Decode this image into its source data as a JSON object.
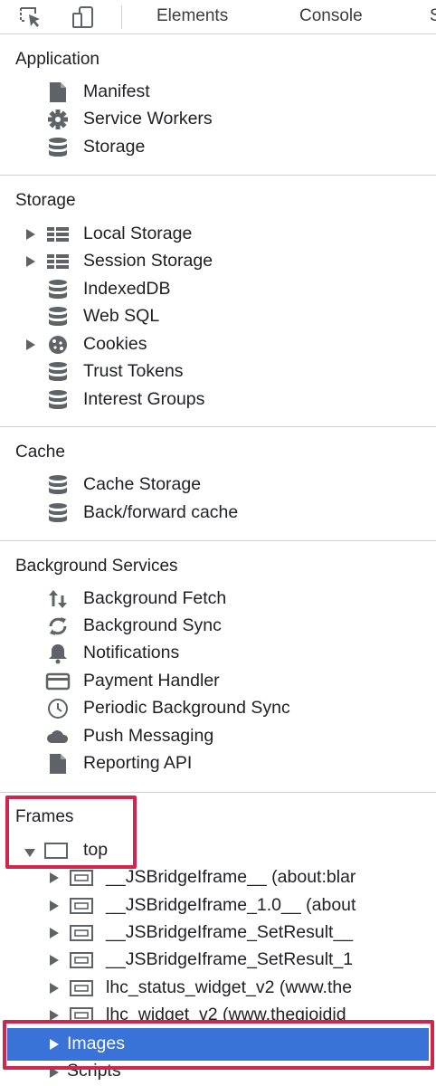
{
  "toolbar": {
    "icons": [
      "inspect-element-icon",
      "device-toggle-icon"
    ],
    "tabs": [
      "Elements",
      "Console",
      "S"
    ]
  },
  "application": {
    "title": "Application",
    "items": [
      {
        "label": "Manifest",
        "icon": "document-icon"
      },
      {
        "label": "Service Workers",
        "icon": "gear-icon"
      },
      {
        "label": "Storage",
        "icon": "database-icon"
      }
    ]
  },
  "storage": {
    "title": "Storage",
    "items": [
      {
        "label": "Local Storage",
        "icon": "table-grid-icon",
        "expandable": true
      },
      {
        "label": "Session Storage",
        "icon": "table-grid-icon",
        "expandable": true
      },
      {
        "label": "IndexedDB",
        "icon": "database-icon"
      },
      {
        "label": "Web SQL",
        "icon": "database-icon"
      },
      {
        "label": "Cookies",
        "icon": "cookie-icon",
        "expandable": true
      },
      {
        "label": "Trust Tokens",
        "icon": "database-icon"
      },
      {
        "label": "Interest Groups",
        "icon": "database-icon"
      }
    ]
  },
  "cache": {
    "title": "Cache",
    "items": [
      {
        "label": "Cache Storage",
        "icon": "database-icon"
      },
      {
        "label": "Back/forward cache",
        "icon": "database-icon"
      }
    ]
  },
  "background_services": {
    "title": "Background Services",
    "items": [
      {
        "label": "Background Fetch",
        "icon": "up-down-arrows-icon"
      },
      {
        "label": "Background Sync",
        "icon": "sync-icon"
      },
      {
        "label": "Notifications",
        "icon": "bell-icon"
      },
      {
        "label": "Payment Handler",
        "icon": "credit-card-icon"
      },
      {
        "label": "Periodic Background Sync",
        "icon": "clock-icon"
      },
      {
        "label": "Push Messaging",
        "icon": "cloud-icon"
      },
      {
        "label": "Reporting API",
        "icon": "document-icon"
      }
    ]
  },
  "frames": {
    "title": "Frames",
    "top_label": "top",
    "children": [
      {
        "label": "__JSBridgeIframe__ (about:blar",
        "icon": "frame-icon"
      },
      {
        "label": "__JSBridgeIframe_1.0__ (about",
        "icon": "frame-icon"
      },
      {
        "label": "__JSBridgeIframe_SetResult__",
        "icon": "frame-icon"
      },
      {
        "label": "__JSBridgeIframe_SetResult_1",
        "icon": "frame-icon"
      },
      {
        "label": "lhc_status_widget_v2 (www.the",
        "icon": "frame-icon"
      },
      {
        "label": "lhc_widget_v2 (www.thegioidid",
        "icon": "frame-icon"
      }
    ],
    "images_label": "Images",
    "scripts_label": "Scripts"
  },
  "colors": {
    "selected": "#3973d8",
    "highlight_border": "#d0264d",
    "icon": "#5f6368"
  }
}
